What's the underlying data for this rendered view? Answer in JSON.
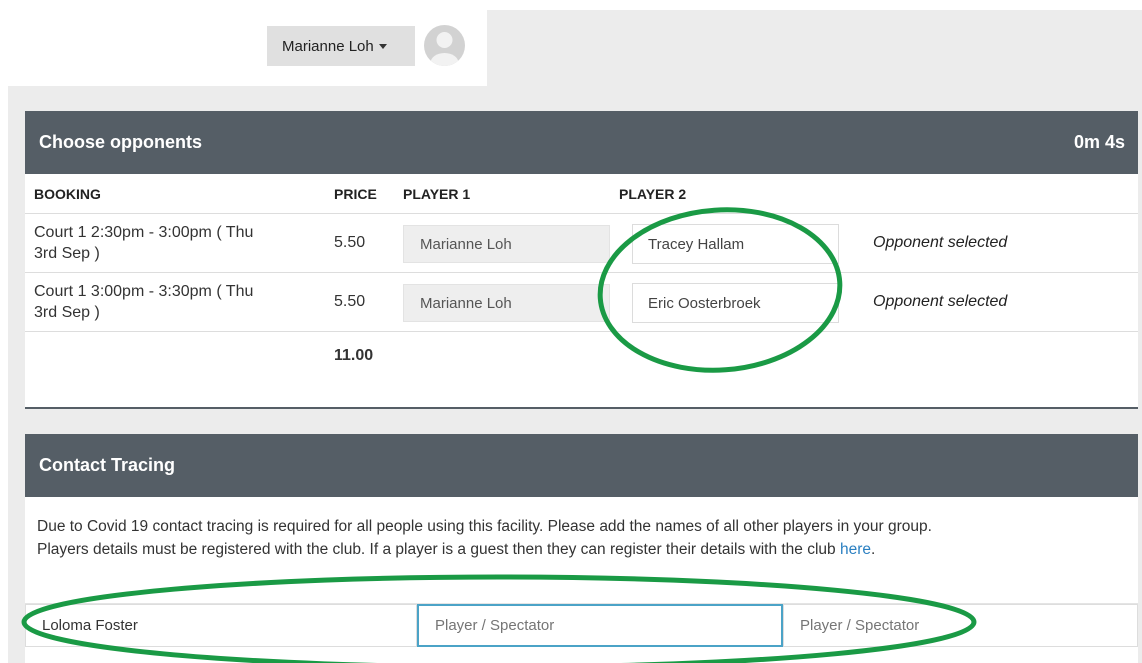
{
  "header": {
    "user_name": "Marianne Loh"
  },
  "opponents_panel": {
    "title": "Choose opponents",
    "timer": "0m 4s",
    "columns": {
      "booking": "BOOKING",
      "price": "PRICE",
      "player1": "PLAYER 1",
      "player2": "PLAYER 2"
    },
    "rows": [
      {
        "booking_line1": "Court 1 2:30pm - 3:00pm ( Thu",
        "booking_line2": "3rd Sep )",
        "price": "5.50",
        "player1": "Marianne Loh",
        "player2": "Tracey Hallam",
        "status": "Opponent selected"
      },
      {
        "booking_line1": "Court 1 3:00pm - 3:30pm ( Thu",
        "booking_line2": "3rd Sep )",
        "price": "5.50",
        "player1": "Marianne Loh",
        "player2": "Eric Oosterbroek",
        "status": "Opponent selected"
      }
    ],
    "total": "11.00"
  },
  "contact_panel": {
    "title": "Contact Tracing",
    "text_line1": "Due to Covid 19 contact tracing is required for all people using this facility. Please add the names of all other players in your group.",
    "text_line2": "Players details must be registered with the club. If a player is a guest then they can register their details with the club",
    "link_text": "here",
    "text_end": ".",
    "inputs": [
      {
        "value": "Loloma Foster",
        "placeholder": ""
      },
      {
        "value": "",
        "placeholder": "Player / Spectator"
      },
      {
        "value": "",
        "placeholder": "Player / Spectator"
      }
    ]
  },
  "colors": {
    "panel_header": "#555e66",
    "annotation": "#1a9a45",
    "link": "#2a7fc1",
    "focus_border": "#4ba3c7"
  }
}
